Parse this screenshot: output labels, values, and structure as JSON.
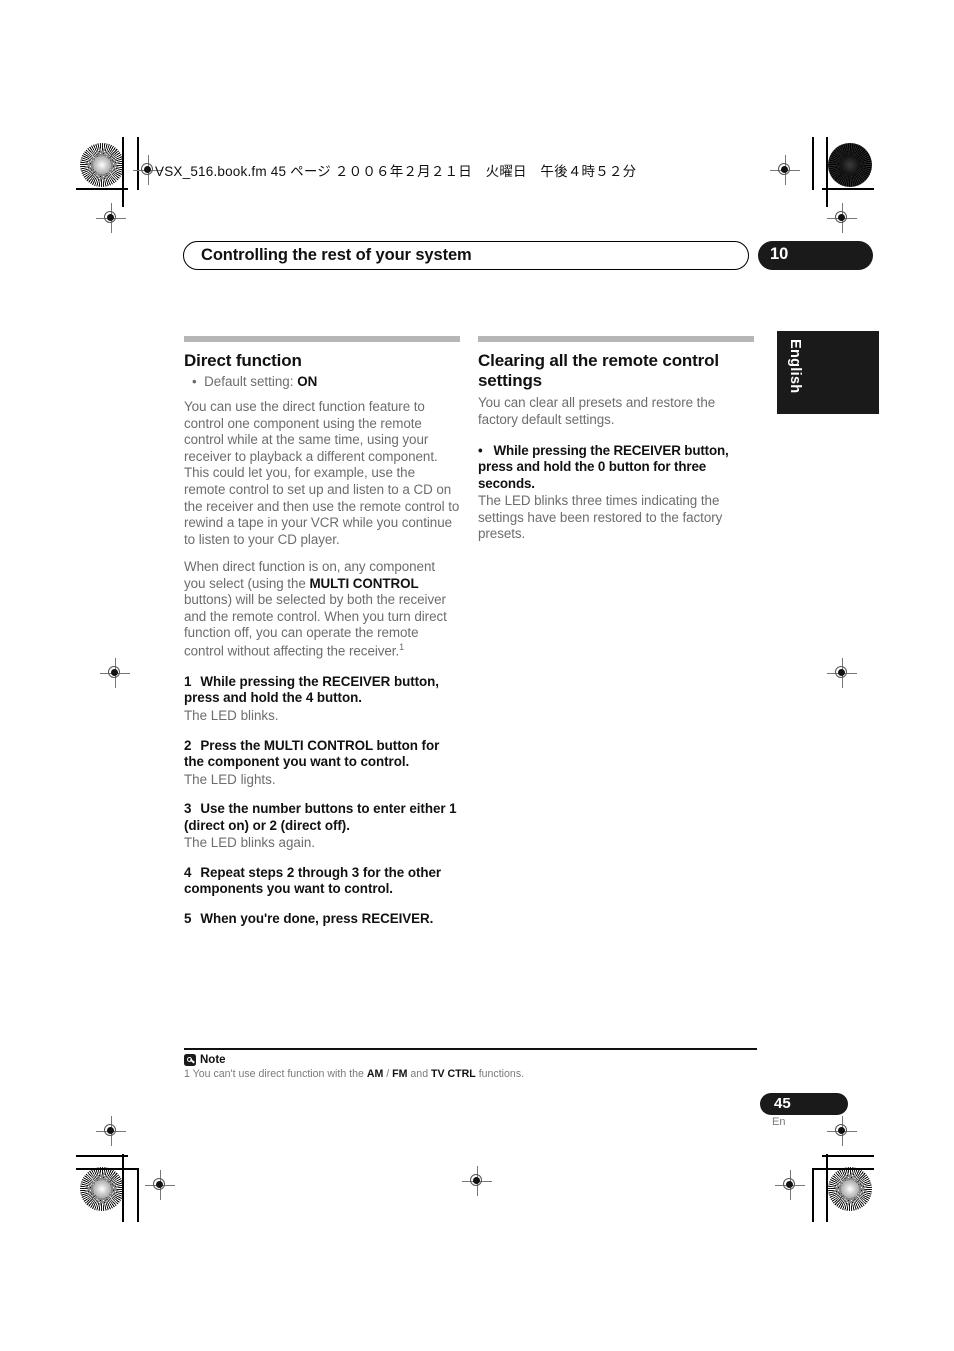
{
  "print_marks": {
    "file_stamp": "VSX_516.book.fm  45 ページ  ２００６年２月２１日　火曜日　午後４時５２分"
  },
  "running_head": {
    "title": "Controlling the rest of your system",
    "chapter_number": "10"
  },
  "language_tab": {
    "label": "English"
  },
  "left_column": {
    "heading": "Direct function",
    "default_setting_bullet_prefix": "Default setting: ",
    "default_setting_value": "ON",
    "intro_paragraph": "You can use the direct function feature to control one component using the remote control while at the same time, using your receiver to playback a different component. This could let you, for example, use the remote control to set up and listen to a CD on the receiver and then use the remote control to rewind a tape in your VCR while you continue to listen to your CD player.",
    "second_paragraph_part1": "When direct function is on, any component you select (using the ",
    "second_paragraph_bold": "MULTI CONTROL",
    "second_paragraph_part2": " buttons) will be selected by both the receiver and the remote control. When you turn direct function off, you can operate the remote control without affecting the receiver.",
    "second_paragraph_footnote_marker": "1",
    "steps": [
      {
        "number": "1",
        "instruction": "While pressing the RECEIVER button, press and hold the 4 button.",
        "result": "The LED blinks."
      },
      {
        "number": "2",
        "instruction": "Press the MULTI CONTROL button for the component you want to control.",
        "result": "The LED lights."
      },
      {
        "number": "3",
        "instruction": "Use the number buttons to enter either 1 (direct on) or 2 (direct off).",
        "result": "The LED blinks again."
      },
      {
        "number": "4",
        "instruction": "Repeat steps 2 through 3 for the other components you want to control.",
        "result": ""
      },
      {
        "number": "5",
        "instruction": "When you're done, press RECEIVER.",
        "result": ""
      }
    ]
  },
  "right_column": {
    "heading": "Clearing all the remote control settings",
    "intro_paragraph": "You can clear all presets and restore the factory default settings.",
    "bullet_instruction": "While pressing the RECEIVER button, press and hold the 0 button for three seconds.",
    "bullet_result": "The LED blinks three times indicating the settings have been restored to the factory presets."
  },
  "footer": {
    "note_label": "Note",
    "footnote_number": "1",
    "footnote_part1": " You can't use direct function with the ",
    "footnote_bold1": "AM",
    "footnote_sep": " / ",
    "footnote_bold2": "FM",
    "footnote_part2": " and ",
    "footnote_bold3": "TV CTRL",
    "footnote_part3": " functions.",
    "page_number": "45",
    "page_language": "En"
  },
  "colors": {
    "ink": "#111111",
    "body_gray": "#6d6d6d",
    "rule_gray": "#b6b6b6",
    "pill_black": "#1a1a1a"
  }
}
